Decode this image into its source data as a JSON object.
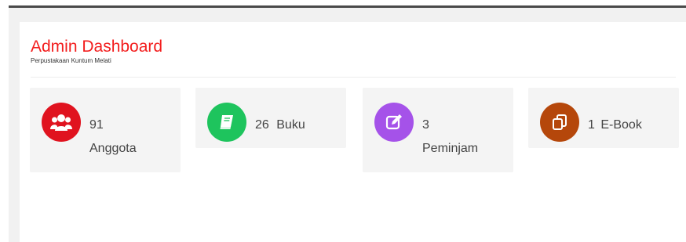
{
  "header": {
    "title": "Admin Dashboard",
    "subtitle": "Perpustakaan Kuntum Melati"
  },
  "cards": [
    {
      "value": "91",
      "label": "Anggota",
      "icon": "users-icon",
      "color": "#e0131f"
    },
    {
      "value": "26",
      "label": "Buku",
      "icon": "book-icon",
      "color": "#1ec45d"
    },
    {
      "value": "3",
      "label": "Peminjam",
      "icon": "edit-icon",
      "color": "#a552e9"
    },
    {
      "value": "1",
      "label": "E-Book",
      "icon": "copy-icon",
      "color": "#b5470b"
    }
  ]
}
